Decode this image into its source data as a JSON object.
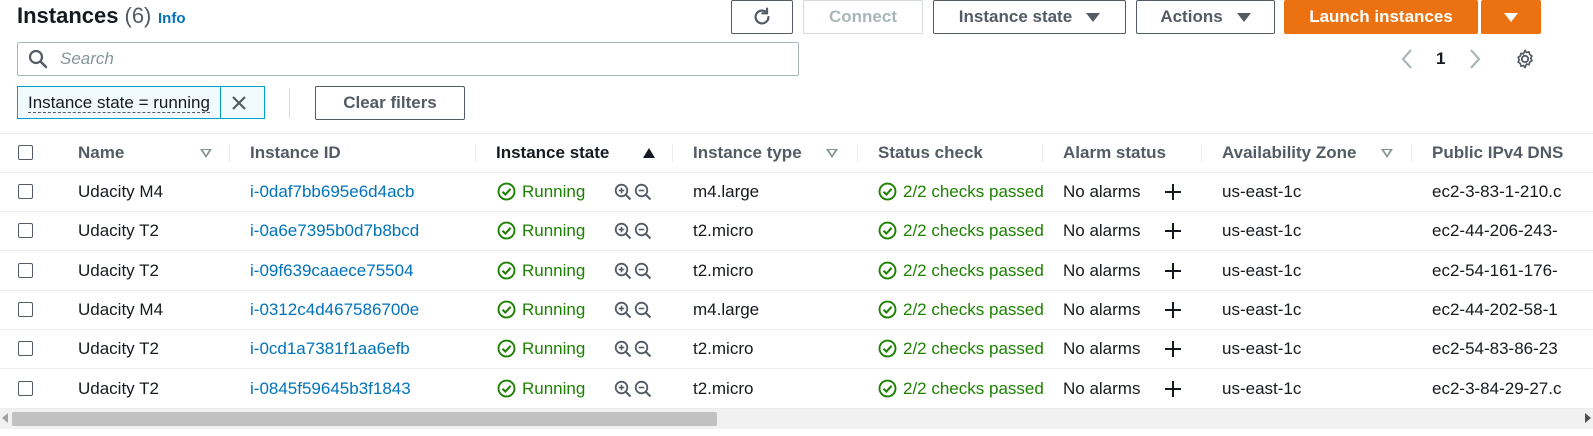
{
  "header": {
    "title": "Instances",
    "count": "(6)",
    "info_link": "Info"
  },
  "toolbar": {
    "refresh_icon": "refresh-icon",
    "connect_label": "Connect",
    "instance_state_label": "Instance state",
    "actions_label": "Actions",
    "launch_label": "Launch instances"
  },
  "search": {
    "placeholder": "Search"
  },
  "pagination": {
    "current_page": "1"
  },
  "filter": {
    "token_label": "Instance state = running",
    "clear_label": "Clear filters"
  },
  "table": {
    "columns": [
      "Name",
      "Instance ID",
      "Instance state",
      "Instance type",
      "Status check",
      "Alarm status",
      "Availability Zone",
      "Public IPv4 DNS"
    ],
    "rows": [
      {
        "name": "Udacity M4",
        "id": "i-0daf7bb695e6d4acb",
        "state": "Running",
        "type": "m4.large",
        "status": "2/2 checks passed",
        "alarm": "No alarms",
        "az": "us-east-1c",
        "dns": "ec2-3-83-1-210.c"
      },
      {
        "name": "Udacity T2",
        "id": "i-0a6e7395b0d7b8bcd",
        "state": "Running",
        "type": "t2.micro",
        "status": "2/2 checks passed",
        "alarm": "No alarms",
        "az": "us-east-1c",
        "dns": "ec2-44-206-243-"
      },
      {
        "name": "Udacity T2",
        "id": "i-09f639caaece75504",
        "state": "Running",
        "type": "t2.micro",
        "status": "2/2 checks passed",
        "alarm": "No alarms",
        "az": "us-east-1c",
        "dns": "ec2-54-161-176-"
      },
      {
        "name": "Udacity M4",
        "id": "i-0312c4d467586700e",
        "state": "Running",
        "type": "m4.large",
        "status": "2/2 checks passed",
        "alarm": "No alarms",
        "az": "us-east-1c",
        "dns": "ec2-44-202-58-1"
      },
      {
        "name": "Udacity T2",
        "id": "i-0cd1a7381f1aa6efb",
        "state": "Running",
        "type": "t2.micro",
        "status": "2/2 checks passed",
        "alarm": "No alarms",
        "az": "us-east-1c",
        "dns": "ec2-54-83-86-23"
      },
      {
        "name": "Udacity T2",
        "id": "i-0845f59645b3f1843",
        "state": "Running",
        "type": "t2.micro",
        "status": "2/2 checks passed",
        "alarm": "No alarms",
        "az": "us-east-1c",
        "dns": "ec2-3-84-29-27.c"
      }
    ]
  },
  "colors": {
    "accent": "#ec7211",
    "link": "#0073bb",
    "success": "#1d8102",
    "filter_border": "#00a1c9"
  }
}
